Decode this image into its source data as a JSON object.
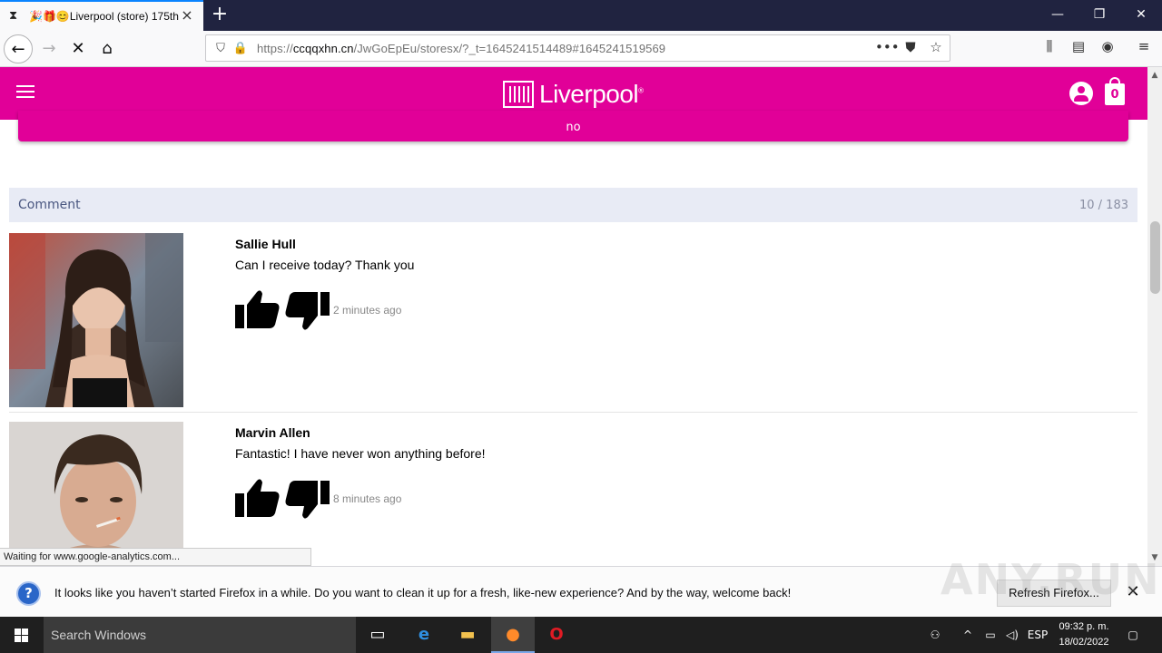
{
  "browser": {
    "tab_title": "Liverpool (store) 175th",
    "tab_favicons": "⧗🎉🎁😊",
    "url_prefix": "https://",
    "url_domain": "ccqqxhn.cn",
    "url_path": "/JwGoEpEu/storesx/?_t=1645241514489#1645241519569",
    "page_actions": "•••",
    "status_text": "Waiting for www.google-analytics.com..."
  },
  "site": {
    "logo_text": "Liverpool",
    "logo_mark": "®",
    "cart_count": "0",
    "banner_text": "no"
  },
  "comments_header": {
    "title": "Comment",
    "count": "10 / 183"
  },
  "comments": [
    {
      "name": "Sallie Hull",
      "text": "Can I receive today? Thank you",
      "time": "2 minutes ago"
    },
    {
      "name": "Marvin Allen",
      "text": "Fantastic! I have never won anything before!",
      "time": "8 minutes ago"
    }
  ],
  "notification": {
    "text": "It looks like you haven’t started Firefox in a while. Do you want to clean it up for a fresh, like-new experience? And by the way, welcome back!",
    "button": "Refresh Firefox...",
    "watermark": "ANY.RUN"
  },
  "taskbar": {
    "search_placeholder": "Search Windows",
    "language": "ESP",
    "time": "09:32 p. m.",
    "date": "18/02/2022"
  },
  "colors": {
    "brand_pink": "#e10098",
    "tab_strip": "#202340"
  }
}
